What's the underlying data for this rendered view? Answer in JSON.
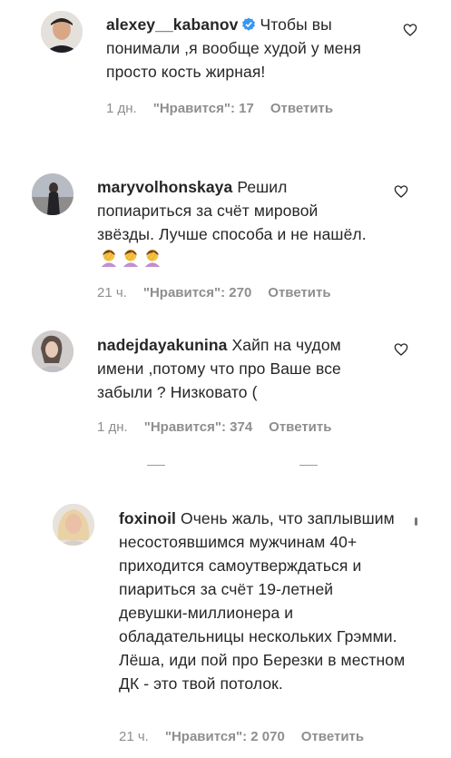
{
  "comments": [
    {
      "username": "alexey__kabanov",
      "verified": true,
      "text": "Чтобы вы понимали ,я вообще худой у меня просто кость жирная!",
      "time": "1 дн.",
      "likes": "\"Нравится\": 17",
      "reply": "Ответить"
    },
    {
      "username": "maryvolhonskaya",
      "verified": false,
      "text": "Решил попиариться за счёт мировой звёзды. Лучше способа и не нашёл.",
      "time": "21 ч.",
      "likes": "\"Нравится\": 270",
      "reply": "Ответить",
      "emoji": [
        "face-palm-emoji",
        "face-palm-emoji",
        "face-palm-emoji"
      ]
    },
    {
      "username": "nadejdayakunina",
      "verified": false,
      "text": "Хайп на чудом имени ,потому что про Ваше все забыли ? Низковато (",
      "time": "1 дн.",
      "likes": "\"Нравится\": 374",
      "reply": "Ответить"
    },
    {
      "username": "foxinoil",
      "verified": false,
      "text": "Очень жаль, что заплывшим несостоявшимся мужчинам 40+ приходится самоутверждаться и пиариться за счёт 19-летней девушки-миллионера и обладательницы нескольких Грэмми. Лёша, иди пой про Березки в местном ДК - это твой потолок.",
      "time": "21 ч.",
      "likes": "\"Нравится\": 2 070",
      "reply": "Ответить"
    }
  ],
  "icons": {
    "like": "heart-outline-icon",
    "verified": "verified-badge-icon"
  },
  "colors": {
    "text": "#262626",
    "meta": "#8e8e8e",
    "verified": "#3897f0",
    "emoji": "#c18fd1"
  }
}
